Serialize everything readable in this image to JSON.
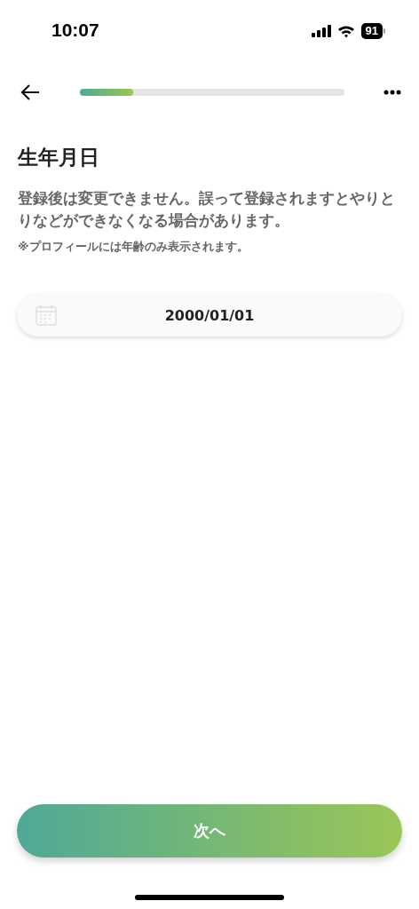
{
  "status_bar": {
    "time": "10:07",
    "battery": "91"
  },
  "progress": {
    "level": 0.2
  },
  "title": "生年月日",
  "description": "登録後は変更できません。誤って登録されますとやりとりなどができなくなる場合があります。",
  "note": "※プロフィールには年齢のみ表示されます。",
  "date_field": {
    "value": "2000/01/01"
  },
  "next_button": {
    "label": "次へ"
  }
}
